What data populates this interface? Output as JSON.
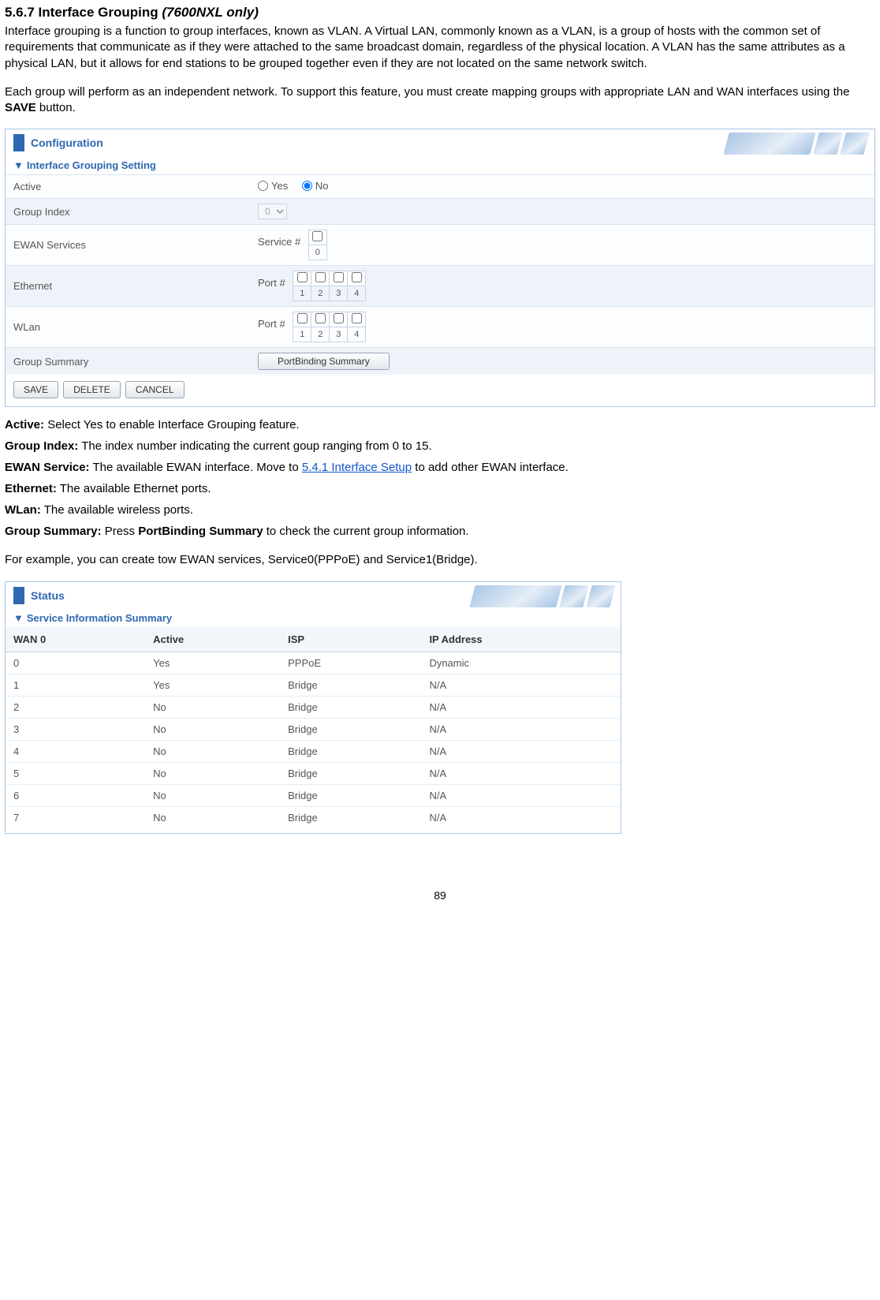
{
  "heading": {
    "number": "5.6.7",
    "title": "Interface Grouping",
    "note": "(7600NXL only)"
  },
  "intro_p1": "Interface grouping is a function to group interfaces, known as VLAN. A Virtual LAN, commonly known as a VLAN, is a group of hosts with the common set of requirements that communicate as if they were attached to the same broadcast domain, regardless of the physical location. A VLAN has the same attributes as a physical LAN, but it allows for end stations to be grouped together even if they are not located on the same network switch.",
  "intro_p2_a": "Each group will perform as an independent network. To support this feature, you must create mapping groups with appropriate LAN and WAN interfaces using the ",
  "intro_p2_bold": "SAVE",
  "intro_p2_b": " button.",
  "config_panel": {
    "header": "Configuration",
    "section": "Interface Grouping Setting",
    "rows": {
      "active": {
        "label": "Active",
        "yes": "Yes",
        "no": "No"
      },
      "group_index": {
        "label": "Group Index",
        "value": "0"
      },
      "ewan": {
        "label": "EWAN Services",
        "prefix": "Service #",
        "ports": [
          "0"
        ]
      },
      "ethernet": {
        "label": "Ethernet",
        "prefix": "Port #",
        "ports": [
          "1",
          "2",
          "3",
          "4"
        ]
      },
      "wlan": {
        "label": "WLan",
        "prefix": "Port #",
        "ports": [
          "1",
          "2",
          "3",
          "4"
        ]
      },
      "summary": {
        "label": "Group Summary",
        "button": "PortBinding Summary"
      }
    },
    "buttons": {
      "save": "SAVE",
      "delete": "DELETE",
      "cancel": "CANCEL"
    }
  },
  "definitions": {
    "active": {
      "term": "Active:",
      "text": " Select Yes to enable Interface Grouping feature."
    },
    "group_index": {
      "term": "Group Index:",
      "text": " The index number indicating the current goup ranging from 0 to 15."
    },
    "ewan": {
      "term": "EWAN Service:",
      "text_a": " The available EWAN interface. Move to ",
      "link": "5.4.1 Interface Setup",
      "text_b": " to add other EWAN interface."
    },
    "ethernet": {
      "term": "Ethernet:",
      "text": " The available Ethernet ports."
    },
    "wlan": {
      "term": "WLan:",
      "text": " The available wireless ports."
    },
    "summary": {
      "term": "Group Summary:",
      "text_a": " Press ",
      "bold": "PortBinding Summary",
      "text_b": " to check the current group information."
    }
  },
  "example_intro": "For example, you can create tow EWAN services, Service0(PPPoE) and Service1(Bridge).",
  "status_panel": {
    "header": "Status",
    "section": "Service Information Summary",
    "columns": [
      "WAN 0",
      "Active",
      "ISP",
      "IP Address"
    ],
    "rows": [
      {
        "wan": "0",
        "active": "Yes",
        "isp": "PPPoE",
        "ip": "Dynamic"
      },
      {
        "wan": "1",
        "active": "Yes",
        "isp": "Bridge",
        "ip": "N/A"
      },
      {
        "wan": "2",
        "active": "No",
        "isp": "Bridge",
        "ip": "N/A"
      },
      {
        "wan": "3",
        "active": "No",
        "isp": "Bridge",
        "ip": "N/A"
      },
      {
        "wan": "4",
        "active": "No",
        "isp": "Bridge",
        "ip": "N/A"
      },
      {
        "wan": "5",
        "active": "No",
        "isp": "Bridge",
        "ip": "N/A"
      },
      {
        "wan": "6",
        "active": "No",
        "isp": "Bridge",
        "ip": "N/A"
      },
      {
        "wan": "7",
        "active": "No",
        "isp": "Bridge",
        "ip": "N/A"
      }
    ]
  },
  "page_number": "89"
}
